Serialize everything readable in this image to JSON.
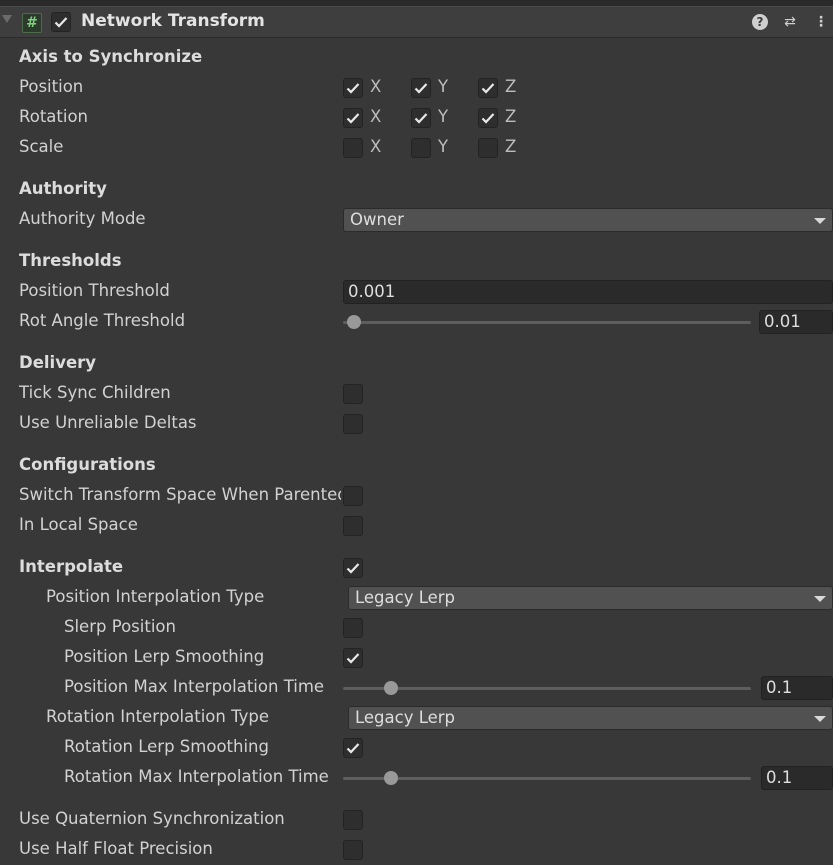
{
  "component": {
    "title": "Network Transform",
    "enabled": true,
    "icons": {
      "component": "hash-script-icon",
      "help": "help-icon",
      "presets": "presets-icon",
      "menu": "kebab-menu-icon"
    },
    "help_glyph": "?",
    "menu_glyph": "⋮",
    "preset_glyph": "⇄"
  },
  "axis": {
    "section": "Axis to Synchronize",
    "rows": [
      {
        "label": "Position",
        "x": true,
        "y": true,
        "z": true
      },
      {
        "label": "Rotation",
        "x": true,
        "y": true,
        "z": true
      },
      {
        "label": "Scale",
        "x": false,
        "y": false,
        "z": false
      }
    ],
    "x_label": "X",
    "y_label": "Y",
    "z_label": "Z"
  },
  "authority": {
    "section": "Authority",
    "mode_label": "Authority Mode",
    "mode_value": "Owner"
  },
  "thresholds": {
    "section": "Thresholds",
    "position_label": "Position Threshold",
    "position_value": "0.001",
    "rot_label": "Rot Angle Threshold",
    "rot_value": "0.01",
    "rot_slider_fraction": 0.01
  },
  "delivery": {
    "section": "Delivery",
    "tick_sync_label": "Tick Sync Children",
    "tick_sync": false,
    "unreliable_label": "Use Unreliable Deltas",
    "unreliable": false
  },
  "configurations": {
    "section": "Configurations",
    "switch_space_label": "Switch Transform Space When Parented",
    "switch_space": false,
    "local_space_label": "In Local Space",
    "local_space": false
  },
  "interpolate": {
    "label": "Interpolate",
    "enabled": true,
    "pos_type_label": "Position Interpolation Type",
    "pos_type_value": "Legacy Lerp",
    "slerp_label": "Slerp Position",
    "slerp": false,
    "pos_smoothing_label": "Position Lerp Smoothing",
    "pos_smoothing": true,
    "pos_max_time_label": "Position Max Interpolation Time",
    "pos_max_time_value": "0.1",
    "pos_max_time_fraction": 0.1,
    "rot_type_label": "Rotation Interpolation Type",
    "rot_type_value": "Legacy Lerp",
    "rot_smoothing_label": "Rotation Lerp Smoothing",
    "rot_smoothing": true,
    "rot_max_time_label": "Rotation Max Interpolation Time",
    "rot_max_time_value": "0.1",
    "rot_max_time_fraction": 0.1
  },
  "misc": {
    "quaternion_label": "Use Quaternion Synchronization",
    "quaternion": false,
    "half_float_label": "Use Half Float Precision",
    "half_float": false
  }
}
